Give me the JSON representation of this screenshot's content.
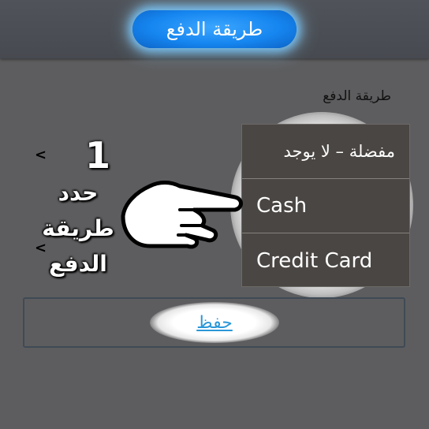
{
  "header": {
    "title": "طريقة الدفع"
  },
  "form": {
    "section_label": "طريقة الدفع",
    "options": [
      {
        "label": "مفضلة – لا يوجد"
      },
      {
        "label": "Cash"
      },
      {
        "label": "Credit Card"
      }
    ],
    "save_label": "حفظ"
  },
  "callout": {
    "step_number": "1",
    "instruction": "حدد\nطريقة\nالدفع"
  },
  "icons": {
    "pointer": "pointing-hand-icon",
    "arrow": "chevron-left-icon"
  },
  "colors": {
    "accent": "#1686f0",
    "link": "#2b97d8",
    "background": "#5d5d5f"
  }
}
